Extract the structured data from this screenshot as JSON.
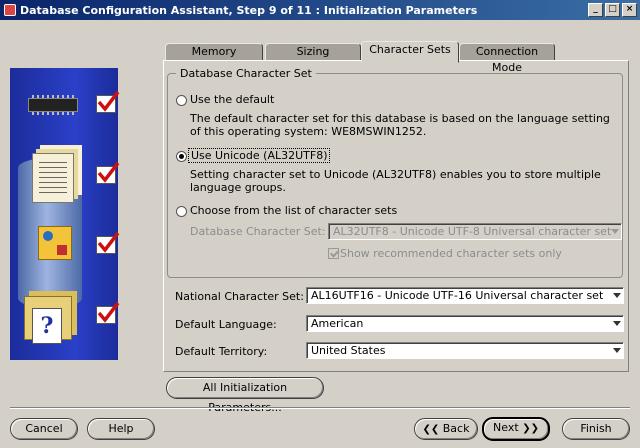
{
  "window": {
    "title": "Database Configuration Assistant, Step 9 of 11 : Initialization Parameters",
    "buttons": [
      "_",
      "□",
      "×"
    ]
  },
  "tabs": [
    {
      "label": "Memory",
      "active": false
    },
    {
      "label": "Sizing",
      "active": false
    },
    {
      "label": "Character Sets",
      "active": true
    },
    {
      "label": "Connection Mode",
      "active": false
    }
  ],
  "db_charset": {
    "legend": "Database Character Set",
    "option_default": {
      "label": "Use the default",
      "desc": "The default character set for this database is based on the language setting of this operating system: WE8MSWIN1252.",
      "selected": false
    },
    "option_unicode": {
      "label": "Use Unicode (AL32UTF8)",
      "desc": "Setting character set to Unicode (AL32UTF8) enables you to store multiple language groups.",
      "selected": true
    },
    "option_list": {
      "label": "Choose from the list of character sets",
      "selected": false,
      "field_label": "Database Character Set:",
      "field_value": "AL32UTF8 - Unicode UTF-8 Universal character set",
      "checkbox_label": "Show recommended character sets only",
      "checkbox_checked": true
    }
  },
  "national": {
    "label": "National Character Set:",
    "value": "AL16UTF16 - Unicode UTF-16 Universal character set"
  },
  "language": {
    "label": "Default Language:",
    "value": "American"
  },
  "territory": {
    "label": "Default Territory:",
    "value": "United States"
  },
  "buttons": {
    "all_params": "All Initialization Parameters...",
    "cancel": "Cancel",
    "help": "Help",
    "back": "Back",
    "next": "Next",
    "finish": "Finish"
  },
  "colors": {
    "window_bg": "#d4d0c8",
    "titlebar": "#0a246a",
    "illustration": "#2a40c8",
    "check_red": "#cc1010"
  },
  "icons": [
    "chip-icon",
    "documents-icon",
    "shapes-icon",
    "folders-help-icon",
    "checkmark-icon"
  ]
}
